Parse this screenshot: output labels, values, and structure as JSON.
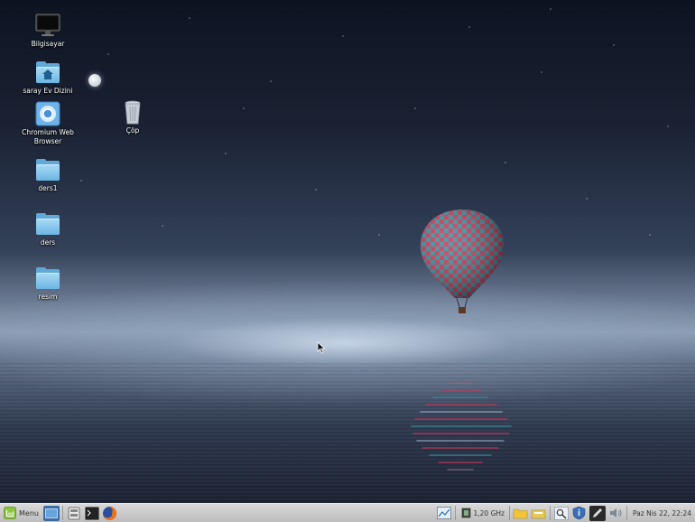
{
  "desktop": {
    "icons": [
      {
        "label": "Bilgisayar",
        "icon": "computer-icon"
      },
      {
        "label": "saray Ev Dizini",
        "icon": "home-folder-icon"
      },
      {
        "label": "Chromium Web Browser",
        "icon": "chromium-icon"
      },
      {
        "label": "ders1",
        "icon": "folder-icon"
      },
      {
        "label": "ders",
        "icon": "folder-icon"
      },
      {
        "label": "resim",
        "icon": "folder-icon"
      },
      {
        "label": "Çöp",
        "icon": "trash-icon"
      }
    ]
  },
  "taskbar": {
    "menu_label": "Menu",
    "cpu_freq": "1,20 GHz",
    "clock": "Paz Nis 22, 22:24",
    "colors": {
      "panel": "#c8c8c8",
      "mint": "#8cc63f"
    }
  }
}
